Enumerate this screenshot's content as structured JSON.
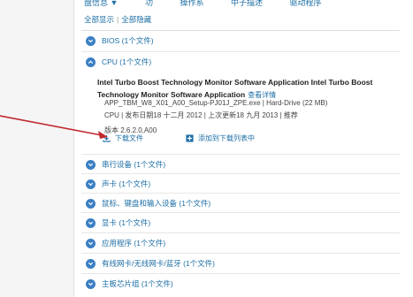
{
  "top": {
    "clipped_items": [
      "盘信息 ▼",
      "功",
      "操作系",
      "中子描述",
      "驱动程序"
    ],
    "show_all": "全部显示",
    "separator": "|",
    "hide_all": "全部隐藏"
  },
  "categories": [
    {
      "label": "BIOS (1个文件)",
      "state": "collapsed"
    },
    {
      "label": "CPU (1个文件)",
      "state": "expanded"
    },
    {
      "label": "串行设备 (1个文件)",
      "state": "collapsed"
    },
    {
      "label": "声卡 (1个文件)",
      "state": "collapsed"
    },
    {
      "label": "鼠标、键盘和输入设备 (1个文件)",
      "state": "collapsed"
    },
    {
      "label": "显卡 (1个文件)",
      "state": "collapsed"
    },
    {
      "label": "应用程序 (1个文件)",
      "state": "collapsed"
    },
    {
      "label": "有线网卡/无线网卡/蓝牙 (1个文件)",
      "state": "collapsed"
    },
    {
      "label": "主板芯片组 (1个文件)",
      "state": "collapsed"
    }
  ],
  "file": {
    "title": "Intel Turbo Boost Technology Monitor Software Application Intel Turbo Boost Technology Monitor Software Application",
    "details_link": "查看详情",
    "filename_line": "APP_TBM_W8_X01_A00_Setup-PJ01J_ZPE.exe | Hard-Drive (22 MB)",
    "info_line": "CPU | 发布日期18 十二月 2012 | 上次更新18 九月 2013 | 推荐",
    "version_line": "版本 2.6.2.0,A00",
    "download_label": "下载文件",
    "add_to_list_label": "添加到下载列表中"
  },
  "colors": {
    "link": "#1d6fa5",
    "chevron": "#3b7fc4",
    "annotation_arrow": "#c0282d"
  },
  "icons": {
    "chevron": "chevron-circle-icon",
    "download": "download-icon",
    "add": "plus-box-icon"
  }
}
